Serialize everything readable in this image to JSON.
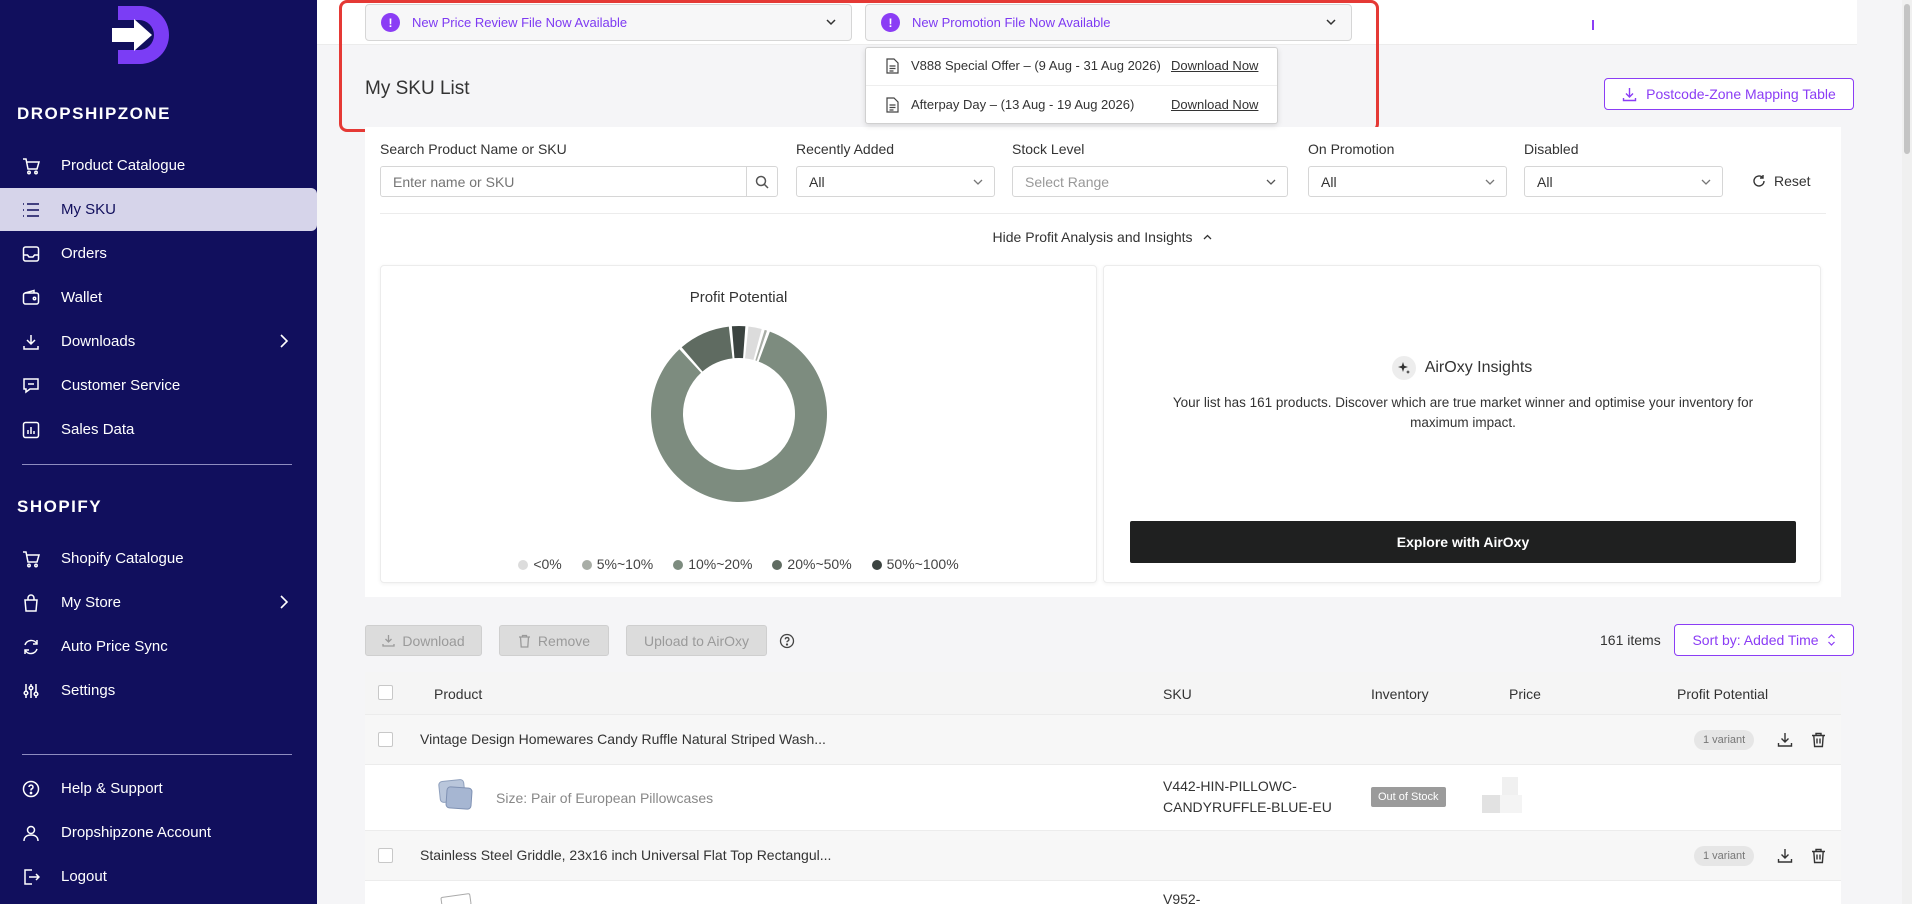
{
  "brand": {
    "name": "DROPSHIPZONE",
    "logo_color": "#7b3df5"
  },
  "sidebar": {
    "section_dropshipzone": "DROPSHIPZONE",
    "section_shopify": "SHOPIFY",
    "items": [
      {
        "label": "Product Catalogue",
        "icon": "cart-icon"
      },
      {
        "label": "My SKU",
        "icon": "list-icon",
        "active": true
      },
      {
        "label": "Orders",
        "icon": "inbox-icon"
      },
      {
        "label": "Wallet",
        "icon": "wallet-icon"
      },
      {
        "label": "Downloads",
        "icon": "download-icon",
        "expandable": true
      },
      {
        "label": "Customer Service",
        "icon": "chat-icon"
      },
      {
        "label": "Sales Data",
        "icon": "bar-chart-icon"
      }
    ],
    "shopify_items": [
      {
        "label": "Shopify Catalogue",
        "icon": "cart-icon"
      },
      {
        "label": "My Store",
        "icon": "bag-icon",
        "expandable": true
      },
      {
        "label": "Auto Price Sync",
        "icon": "sync-icon"
      },
      {
        "label": "Settings",
        "icon": "sliders-icon"
      }
    ],
    "bottom_items": [
      {
        "label": "Help & Support",
        "icon": "help-icon"
      },
      {
        "label": "Dropshipzone Account",
        "icon": "user-icon"
      },
      {
        "label": "Logout",
        "icon": "logout-icon"
      }
    ]
  },
  "notices": {
    "price_review": "New Price Review File Now Available",
    "promotion": "New Promotion File Now Available",
    "promotion_files": [
      {
        "name": "V888 Special Offer – (9 Aug - 31 Aug 2026)",
        "action": "Download Now"
      },
      {
        "name": "Afterpay Day – (13 Aug - 19 Aug 2026)",
        "action": "Download Now"
      }
    ]
  },
  "page": {
    "title": "My SKU List",
    "postcode_button": "Postcode-Zone Mapping Table"
  },
  "filters": {
    "search_label": "Search Product Name or SKU",
    "search_placeholder": "Enter name or SKU",
    "recently_added_label": "Recently Added",
    "recently_added_value": "All",
    "stock_level_label": "Stock Level",
    "stock_level_value": "Select Range",
    "on_promotion_label": "On Promotion",
    "on_promotion_value": "All",
    "disabled_label": "Disabled",
    "disabled_value": "All",
    "reset_label": "Reset",
    "hide_analysis": "Hide Profit Analysis and Insights"
  },
  "chart_data": {
    "type": "pie",
    "title": "Profit Potential",
    "donut": true,
    "categories": [
      "<0%",
      "5%~10%",
      "10%~20%",
      "20%~50%",
      "50%~100%"
    ],
    "values": [
      3,
      1,
      83,
      10,
      3
    ],
    "colors": [
      "#dcdcdc",
      "#a8ada6",
      "#7d8c7f",
      "#5f6b61",
      "#3b4340"
    ]
  },
  "insights": {
    "title": "AirOxy Insights",
    "text": "Your list has 161 products. Discover which are true market winner and optimise your inventory for maximum impact.",
    "button": "Explore with AirOxy"
  },
  "toolbar": {
    "download": "Download",
    "remove": "Remove",
    "upload": "Upload to AirOxy",
    "count": "161 items",
    "sort": "Sort by: Added Time"
  },
  "table": {
    "headers": {
      "product": "Product",
      "sku": "SKU",
      "inventory": "Inventory",
      "price": "Price",
      "profit": "Profit Potential"
    },
    "rows": [
      {
        "name": "Vintage Design Homewares Candy Ruffle Natural Striped Wash...",
        "variants": "1 variant",
        "variant": {
          "size": "Size: Pair of European Pillowcases",
          "sku_line1": "V442-HIN-PILLOWC-",
          "sku_line2": "CANDYRUFFLE-BLUE-EU",
          "stock": "Out of Stock"
        }
      },
      {
        "name": "Stainless Steel Griddle, 23x16 inch Universal Flat Top Rectangul...",
        "variants": "1 variant",
        "variant": {
          "sku_line1": "V952-"
        }
      }
    ]
  }
}
